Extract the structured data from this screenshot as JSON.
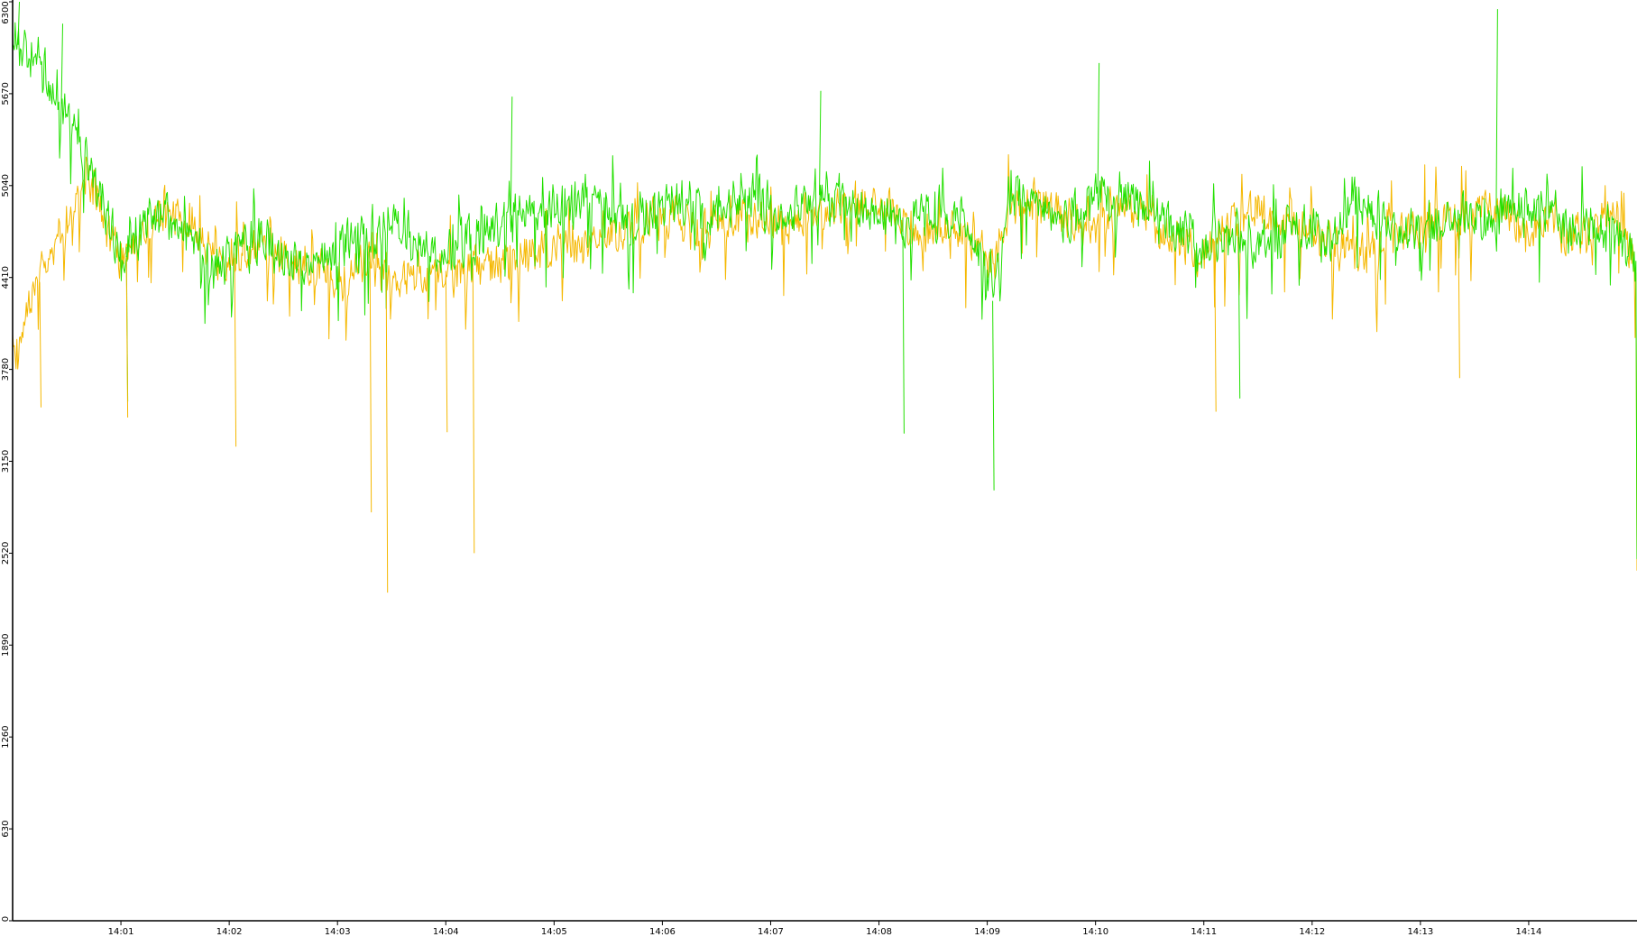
{
  "chart_data": {
    "type": "line",
    "title": "",
    "xlabel": "",
    "ylabel": "",
    "ylim": [
      0,
      6300
    ],
    "y_ticks": [
      "0",
      "630",
      "1260",
      "1890",
      "2520",
      "3150",
      "3780",
      "4410",
      "5040",
      "5670",
      "6300"
    ],
    "x_ticks": [
      "14:01",
      "14:02",
      "14:03",
      "14:04",
      "14:05",
      "14:06",
      "14:07",
      "14:08",
      "14:09",
      "14:10",
      "14:11",
      "14:12",
      "14:13",
      "14:14"
    ],
    "x_range_minutes": [
      0,
      15
    ],
    "grid": false,
    "legend": "none",
    "series_shape_points": [
      [
        0.0,
        6060,
        3780
      ],
      [
        0.1,
        5950,
        4130
      ],
      [
        0.25,
        5880,
        4380
      ],
      [
        0.4,
        5650,
        4600
      ],
      [
        0.55,
        5450,
        4880
      ],
      [
        0.7,
        5150,
        5050
      ],
      [
        0.85,
        4870,
        4780
      ],
      [
        1.0,
        4580,
        4530
      ],
      [
        1.15,
        4700,
        4590
      ],
      [
        1.3,
        4880,
        4800
      ],
      [
        1.5,
        4800,
        4850
      ],
      [
        1.7,
        4600,
        4700
      ],
      [
        1.9,
        4500,
        4500
      ],
      [
        2.1,
        4640,
        4560
      ],
      [
        2.3,
        4700,
        4620
      ],
      [
        2.5,
        4560,
        4560
      ],
      [
        2.7,
        4420,
        4490
      ],
      [
        2.9,
        4560,
        4450
      ],
      [
        3.1,
        4630,
        4400
      ],
      [
        3.3,
        4720,
        4520
      ],
      [
        3.5,
        4780,
        4420
      ],
      [
        3.7,
        4660,
        4380
      ],
      [
        3.9,
        4560,
        4450
      ],
      [
        4.1,
        4630,
        4460
      ],
      [
        4.3,
        4700,
        4480
      ],
      [
        4.5,
        4780,
        4500
      ],
      [
        4.7,
        4890,
        4560
      ],
      [
        4.9,
        4820,
        4600
      ],
      [
        5.1,
        4870,
        4640
      ],
      [
        5.3,
        4950,
        4650
      ],
      [
        5.5,
        4860,
        4680
      ],
      [
        5.7,
        4790,
        4720
      ],
      [
        5.9,
        4870,
        4800
      ],
      [
        6.1,
        4930,
        4790
      ],
      [
        6.3,
        4870,
        4740
      ],
      [
        6.5,
        4830,
        4780
      ],
      [
        6.7,
        4900,
        4830
      ],
      [
        6.9,
        4930,
        4840
      ],
      [
        7.1,
        4790,
        4750
      ],
      [
        7.3,
        4870,
        4840
      ],
      [
        7.5,
        5010,
        4890
      ],
      [
        7.7,
        4910,
        4900
      ],
      [
        7.9,
        4850,
        4960
      ],
      [
        8.1,
        4850,
        4890
      ],
      [
        8.3,
        4800,
        4750
      ],
      [
        8.5,
        4880,
        4690
      ],
      [
        8.7,
        4850,
        4750
      ],
      [
        8.9,
        4630,
        4670
      ],
      [
        9.05,
        4250,
        4520
      ],
      [
        9.2,
        5000,
        4840
      ],
      [
        9.4,
        4980,
        4920
      ],
      [
        9.6,
        4870,
        4870
      ],
      [
        9.8,
        4830,
        4770
      ],
      [
        10.0,
        4990,
        4830
      ],
      [
        10.2,
        4960,
        4880
      ],
      [
        10.4,
        4910,
        4860
      ],
      [
        10.6,
        4800,
        4720
      ],
      [
        10.8,
        4730,
        4620
      ],
      [
        11.0,
        4640,
        4560
      ],
      [
        11.2,
        4730,
        4760
      ],
      [
        11.4,
        4660,
        4890
      ],
      [
        11.6,
        4610,
        4810
      ],
      [
        11.8,
        4770,
        4750
      ],
      [
        12.0,
        4740,
        4720
      ],
      [
        12.2,
        4700,
        4650
      ],
      [
        12.4,
        4980,
        4580
      ],
      [
        12.6,
        4840,
        4620
      ],
      [
        12.8,
        4760,
        4700
      ],
      [
        13.0,
        4730,
        4760
      ],
      [
        13.2,
        4830,
        4820
      ],
      [
        13.4,
        4850,
        4800
      ],
      [
        13.6,
        4820,
        4900
      ],
      [
        13.8,
        4870,
        4830
      ],
      [
        14.0,
        4880,
        4720
      ],
      [
        14.2,
        4920,
        4830
      ],
      [
        14.4,
        4730,
        4680
      ],
      [
        14.6,
        4730,
        4780
      ],
      [
        14.8,
        4700,
        4880
      ],
      [
        14.98,
        4500,
        4500
      ]
    ],
    "series_endpoints": {
      "start_x_min": 0.0,
      "end_x_min": 15.0,
      "end_drop_values": [
        2480,
        2400
      ]
    },
    "series_spikes": [
      {
        "x": 0.05,
        "s": 0,
        "v": 6300
      },
      {
        "x": 0.45,
        "s": 0,
        "v": 6150
      },
      {
        "x": 4.6,
        "s": 0,
        "v": 5650
      },
      {
        "x": 7.45,
        "s": 0,
        "v": 5690
      },
      {
        "x": 9.05,
        "s": 0,
        "v": 2950
      },
      {
        "x": 10.02,
        "s": 0,
        "v": 5880
      },
      {
        "x": 13.7,
        "s": 0,
        "v": 6250
      },
      {
        "x": 1.05,
        "s": 0,
        "v": 3560
      },
      {
        "x": 8.22,
        "s": 0,
        "v": 3340
      },
      {
        "x": 11.32,
        "s": 0,
        "v": 3580
      },
      {
        "x": 3.3,
        "s": 1,
        "v": 2800
      },
      {
        "x": 3.45,
        "s": 1,
        "v": 2250
      },
      {
        "x": 4.25,
        "s": 1,
        "v": 2520
      },
      {
        "x": 1.05,
        "s": 1,
        "v": 3450
      },
      {
        "x": 2.05,
        "s": 1,
        "v": 3250
      },
      {
        "x": 4.0,
        "s": 1,
        "v": 3350
      },
      {
        "x": 0.25,
        "s": 1,
        "v": 3520
      },
      {
        "x": 13.35,
        "s": 1,
        "v": 3720
      },
      {
        "x": 11.1,
        "s": 1,
        "v": 3490
      }
    ],
    "series": [
      {
        "color": "#22e000"
      },
      {
        "color": "#f5b800"
      }
    ]
  }
}
